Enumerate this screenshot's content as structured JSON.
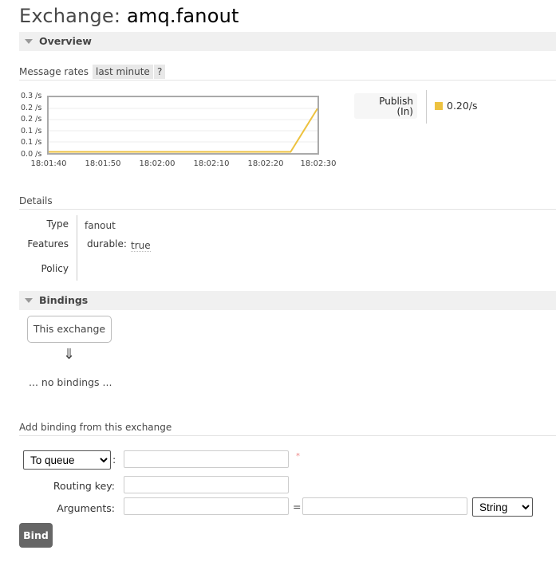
{
  "page": {
    "title_prefix": "Exchange:",
    "title_name": "amq.fanout"
  },
  "overview": {
    "header": "Overview",
    "message_rates_label": "Message rates",
    "range_label": "last minute",
    "help_label": "?",
    "legend": {
      "label_line1": "Publish",
      "label_line2": "(In)",
      "value": "0.20/s",
      "color": "#edc240"
    }
  },
  "chart_data": {
    "type": "line",
    "title": "",
    "xlabel": "",
    "ylabel": "",
    "x_tick_labels": [
      "18:01:40",
      "18:01:50",
      "18:02:00",
      "18:02:10",
      "18:02:20",
      "18:02:30"
    ],
    "y_tick_labels": [
      "0.0 /s",
      "0.1 /s",
      "0.1 /s",
      "0.2 /s",
      "0.2 /s",
      "0.3 /s"
    ],
    "ylim": [
      0,
      0.25
    ],
    "grid": true,
    "series": [
      {
        "name": "Publish (In)",
        "color": "#edc240",
        "x_seconds": [
          0,
          45,
          50
        ],
        "values": [
          0.0,
          0.0,
          0.2
        ]
      }
    ]
  },
  "details": {
    "header": "Details",
    "rows": [
      {
        "label": "Type",
        "value": "fanout"
      },
      {
        "label": "Features",
        "key": "durable:",
        "value": "true"
      },
      {
        "label": "Policy",
        "value": ""
      }
    ]
  },
  "bindings": {
    "header": "Bindings",
    "source_box": "This exchange",
    "arrow": "⇓",
    "empty_text": "... no bindings ..."
  },
  "add_binding": {
    "header": "Add binding from this exchange",
    "destination_type": {
      "selected": "To queue"
    },
    "destination_colon": ":",
    "destination_value": "",
    "required_marker": "*",
    "routing_key_label": "Routing key:",
    "routing_key_value": "",
    "arguments_label": "Arguments:",
    "argument_key_value": "",
    "equals": "=",
    "argument_value": "",
    "argument_type": {
      "selected": "String"
    },
    "bind_button": "Bind"
  }
}
